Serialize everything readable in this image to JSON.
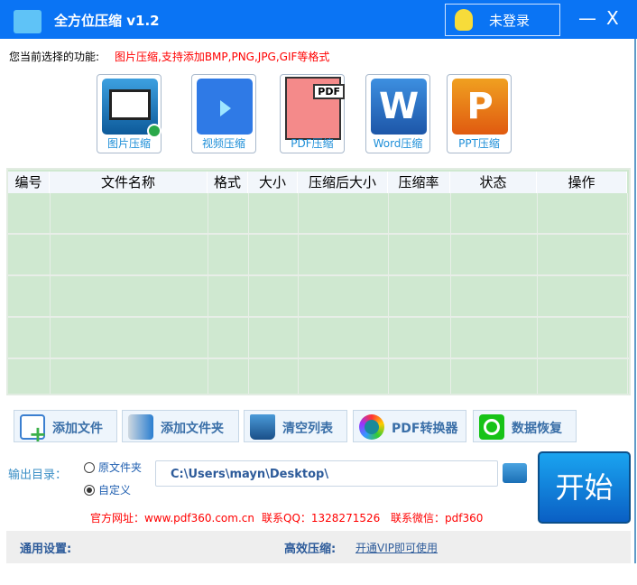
{
  "window": {
    "title": "全方位压缩 v1.2",
    "login_label": "未登录",
    "minimize": "—",
    "close": "X"
  },
  "function": {
    "label": "您当前选择的功能:",
    "value": "图片压缩,支持添加BMP,PNG,JPG,GIF等格式"
  },
  "modes": [
    {
      "label": "图片压缩",
      "selected": true
    },
    {
      "label": "视频压缩"
    },
    {
      "label": "PDF压缩",
      "badge": "PDF"
    },
    {
      "label": "Word压缩"
    },
    {
      "label": "PPT压缩"
    }
  ],
  "table": {
    "columns": [
      "编号",
      "文件名称",
      "格式",
      "大小",
      "压缩后大小",
      "压缩率",
      "状态",
      "操作"
    ],
    "rows": []
  },
  "toolbar": [
    {
      "label": "添加文件"
    },
    {
      "label": "添加文件夹"
    },
    {
      "label": "清空列表"
    },
    {
      "label": "PDF转换器"
    },
    {
      "label": "数据恢复"
    }
  ],
  "output": {
    "label": "输出目录：",
    "option_original": "原文件夹",
    "option_custom": "自定义",
    "selected": "custom",
    "path": "C:\\Users\\mayn\\Desktop\\"
  },
  "start_label": "开始",
  "contact": {
    "site": "官方网址：www.pdf360.com.cn",
    "qq": "联系QQ：1328271526",
    "wechat": "联系微信：pdf360"
  },
  "footer": {
    "general": "通用设置:",
    "efficient": "高效压缩:",
    "vip_link": "开通VIP即可使用"
  }
}
